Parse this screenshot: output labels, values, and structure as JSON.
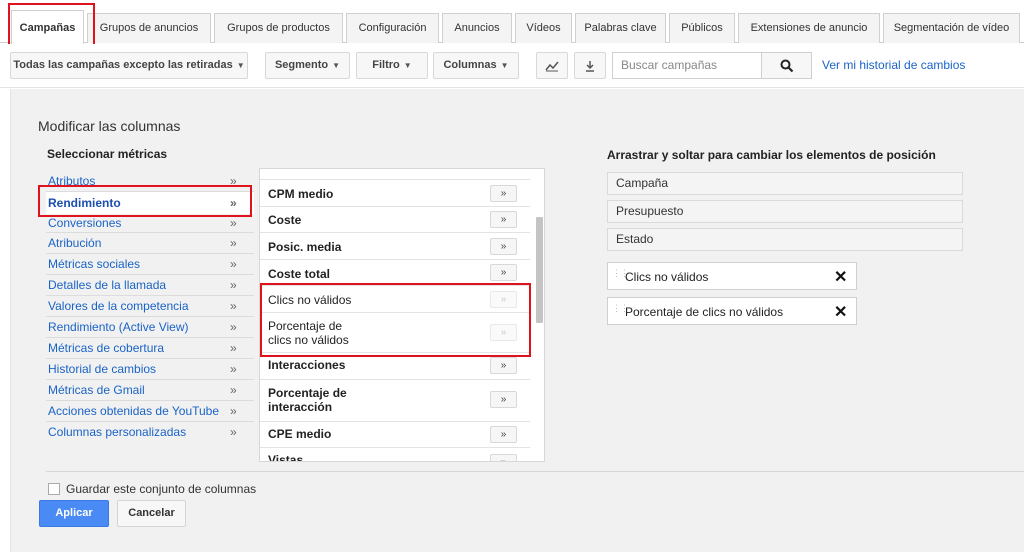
{
  "tabs": [
    {
      "label": "Campañas",
      "active": true
    },
    {
      "label": "Grupos de anuncios"
    },
    {
      "label": "Grupos de productos"
    },
    {
      "label": "Configuración"
    },
    {
      "label": "Anuncios"
    },
    {
      "label": "Vídeos"
    },
    {
      "label": "Palabras clave"
    },
    {
      "label": "Públicos"
    },
    {
      "label": "Extensiones de anuncio"
    },
    {
      "label": "Segmentación de vídeo"
    }
  ],
  "toolbar": {
    "filter_campaigns": "Todas las campañas excepto las retiradas",
    "segment": "Segmento",
    "filter": "Filtro",
    "columns": "Columnas",
    "chart_icon": "line-chart-icon",
    "download_icon": "download-icon",
    "search_placeholder": "Buscar campañas",
    "search_icon": "search-icon",
    "history_link": "Ver mi historial de cambios"
  },
  "panel": {
    "title": "Modificar las columnas",
    "select_metrics": "Seleccionar métricas",
    "drag_title": "Arrastrar y soltar para cambiar los elementos de posición"
  },
  "categories": [
    {
      "label": "Atributos"
    },
    {
      "label": "Rendimiento",
      "active": true
    },
    {
      "label": "Conversiones"
    },
    {
      "label": "Atribución"
    },
    {
      "label": "Métricas sociales"
    },
    {
      "label": "Detalles de la llamada"
    },
    {
      "label": "Valores de la competencia"
    },
    {
      "label": "Rendimiento (Active View)"
    },
    {
      "label": "Métricas de cobertura"
    },
    {
      "label": "Historial de cambios"
    },
    {
      "label": "Métricas de Gmail"
    },
    {
      "label": "Acciones obtenidas de YouTube"
    },
    {
      "label": "Columnas personalizadas"
    }
  ],
  "category_arrow": "»",
  "metrics": [
    {
      "label": "CPM medio",
      "bold": true
    },
    {
      "label": "Coste",
      "bold": true
    },
    {
      "label": "Posic. media",
      "bold": true
    },
    {
      "label": "Coste total",
      "bold": true
    },
    {
      "label": "Clics no válidos",
      "bold": false,
      "disabled": true
    },
    {
      "label": "Porcentaje de clics no válidos",
      "label_l1": "Porcentaje de",
      "label_l2": "clics no válidos",
      "bold": false,
      "disabled": true
    },
    {
      "label": "Interacciones",
      "bold": true
    },
    {
      "label": "Porcentaje de interacción",
      "label_l1": "Porcentaje de",
      "label_l2": "interacción",
      "bold": true
    },
    {
      "label": "CPE medio",
      "bold": true
    },
    {
      "label": "Vistas",
      "bold": true
    }
  ],
  "metric_add_label": "»",
  "fixed_columns": [
    "Campaña",
    "Presupuesto",
    "Estado"
  ],
  "selected_columns": [
    "Clics no válidos",
    "Porcentaje de clics no válidos"
  ],
  "remove_icon": "close-icon",
  "footer": {
    "save_set": "Guardar este conjunto de columnas",
    "apply": "Aplicar",
    "cancel": "Cancelar"
  }
}
